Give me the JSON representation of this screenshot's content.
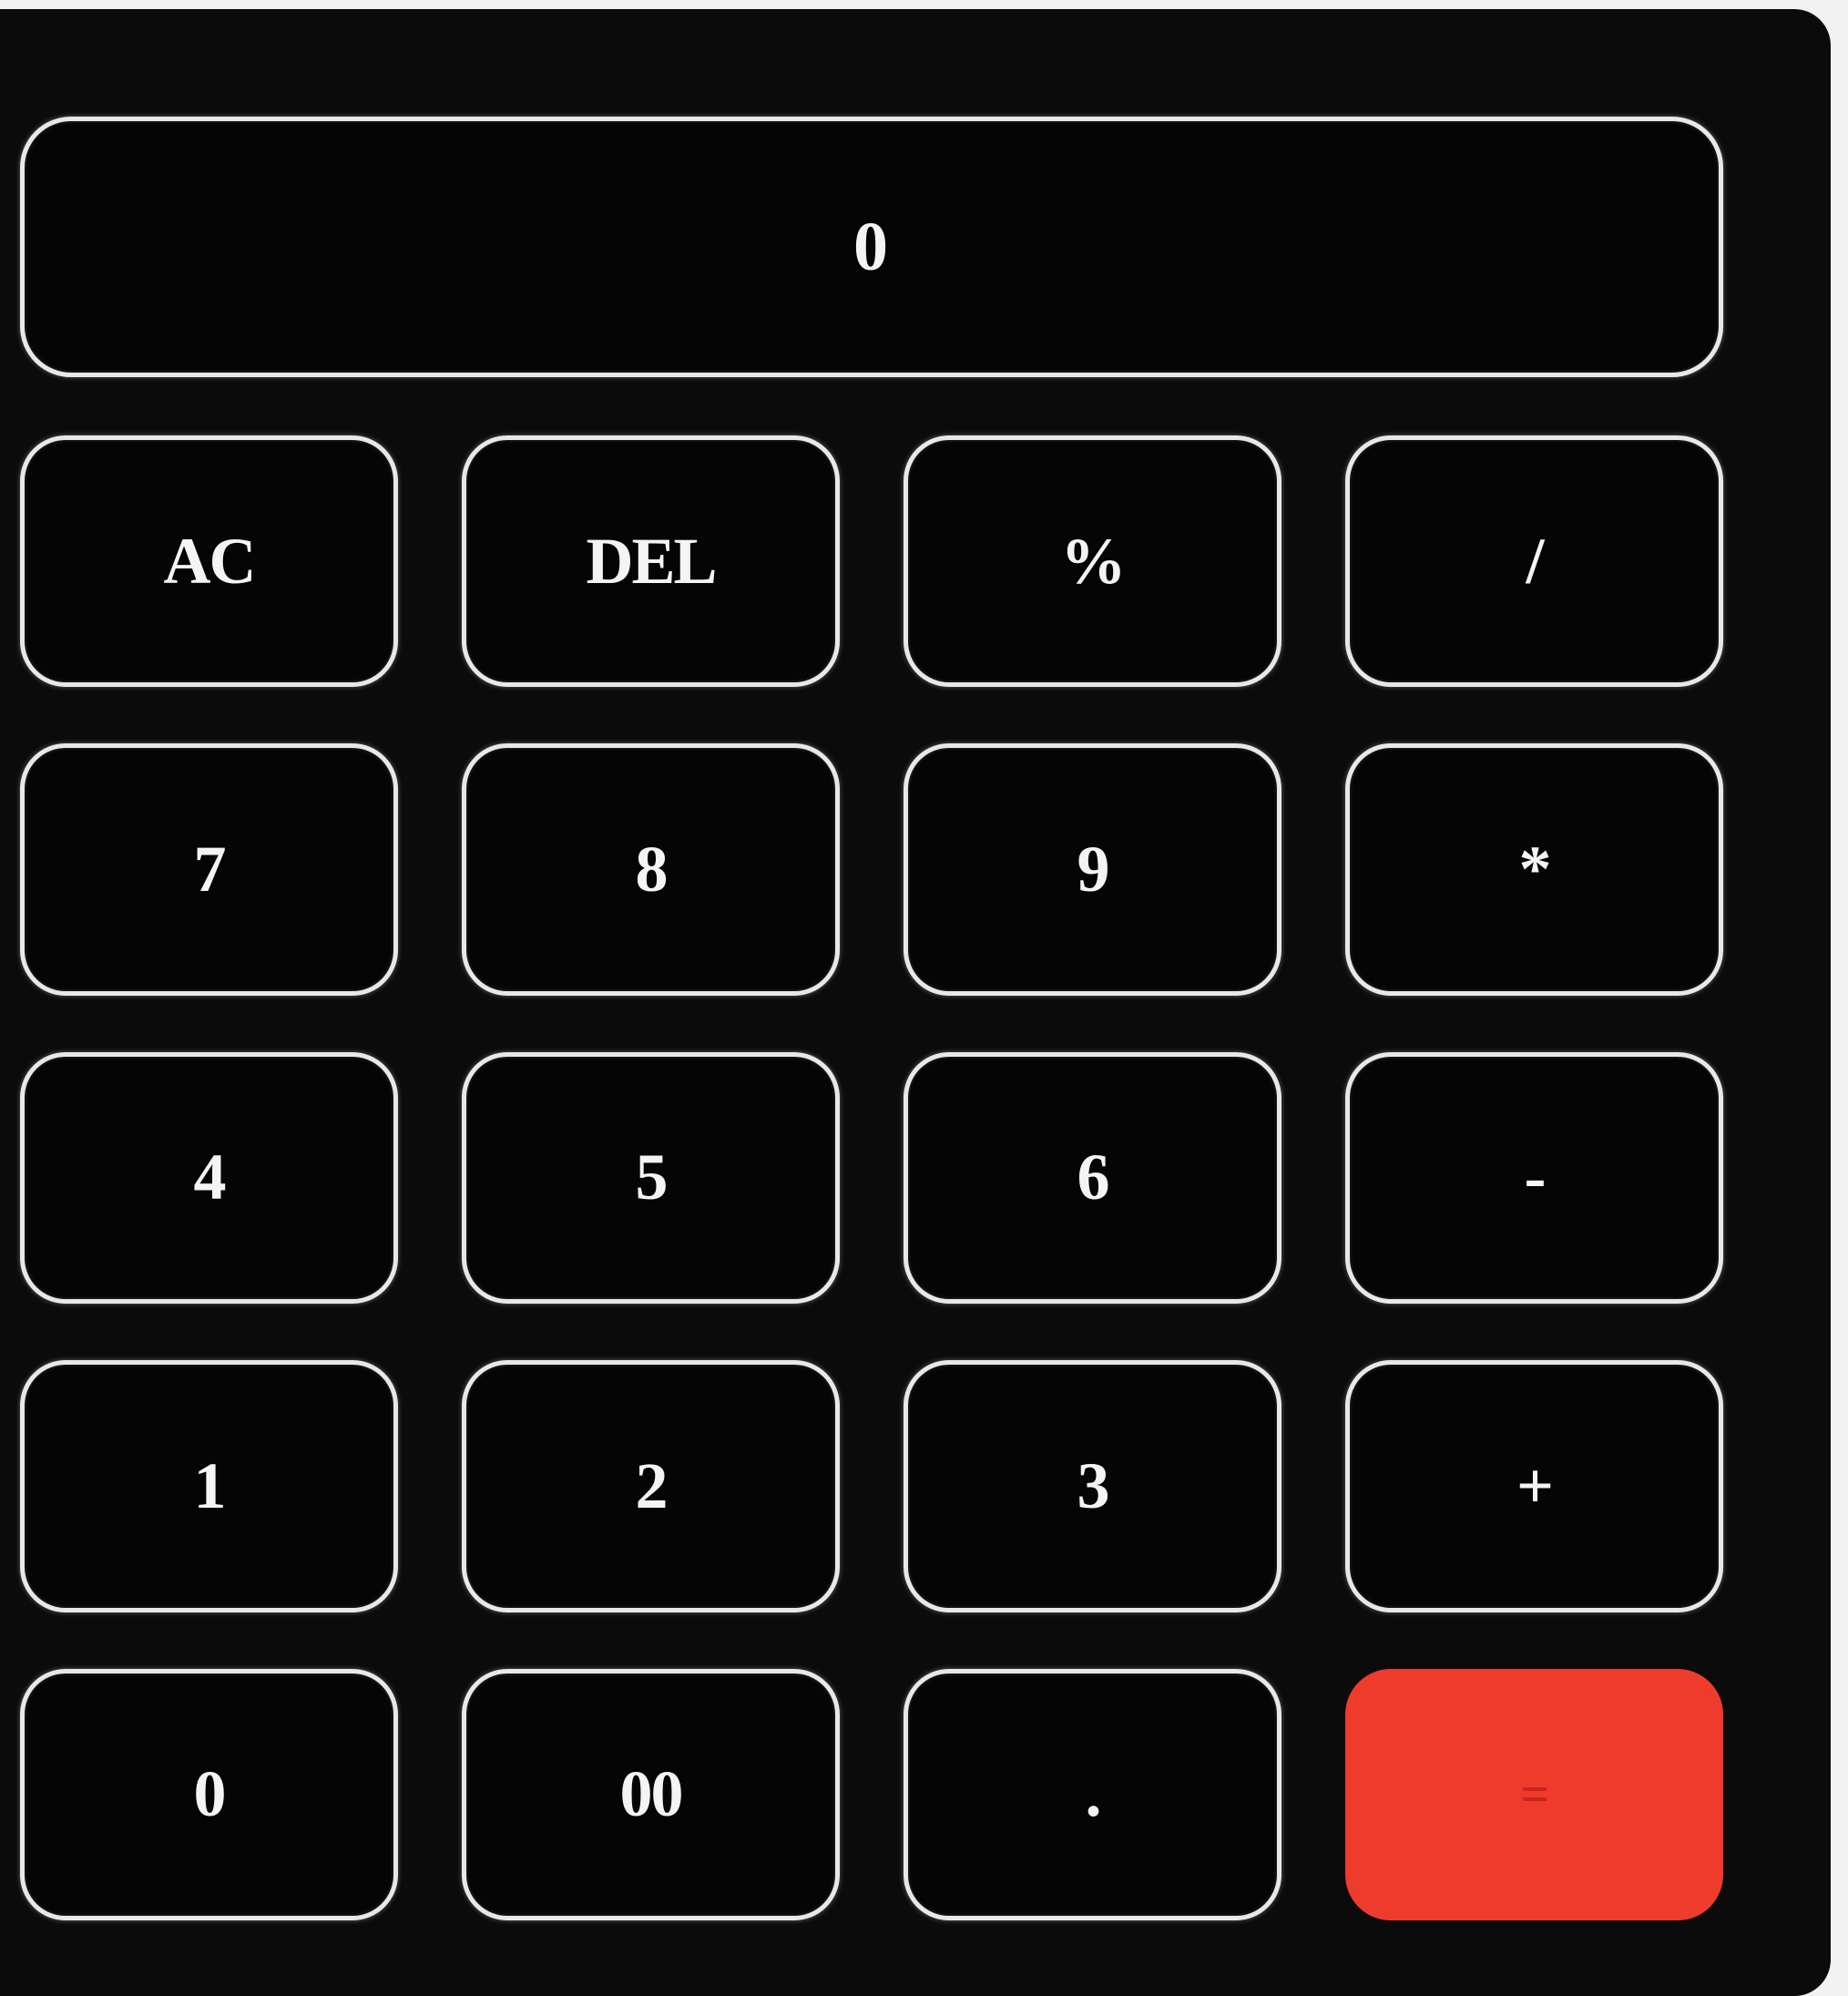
{
  "display": {
    "value": "0"
  },
  "keys": [
    {
      "label": "AC",
      "name": "ac-button"
    },
    {
      "label": "DEL",
      "name": "del-button"
    },
    {
      "label": "%",
      "name": "percent-button"
    },
    {
      "label": "/",
      "name": "divide-button"
    },
    {
      "label": "7",
      "name": "digit-7-button"
    },
    {
      "label": "8",
      "name": "digit-8-button"
    },
    {
      "label": "9",
      "name": "digit-9-button"
    },
    {
      "label": "*",
      "name": "multiply-button"
    },
    {
      "label": "4",
      "name": "digit-4-button"
    },
    {
      "label": "5",
      "name": "digit-5-button"
    },
    {
      "label": "6",
      "name": "digit-6-button"
    },
    {
      "label": "-",
      "name": "subtract-button"
    },
    {
      "label": "1",
      "name": "digit-1-button"
    },
    {
      "label": "2",
      "name": "digit-2-button"
    },
    {
      "label": "3",
      "name": "digit-3-button"
    },
    {
      "label": "+",
      "name": "add-button"
    },
    {
      "label": "0",
      "name": "digit-0-button"
    },
    {
      "label": "00",
      "name": "double-zero-button"
    },
    {
      "label": ".",
      "name": "decimal-button"
    },
    {
      "label": "=",
      "name": "equals-button"
    }
  ],
  "colors": {
    "body": "#0b0b0b",
    "key_border": "#e8e8e8",
    "equals_accent": "#ef3b2c"
  }
}
